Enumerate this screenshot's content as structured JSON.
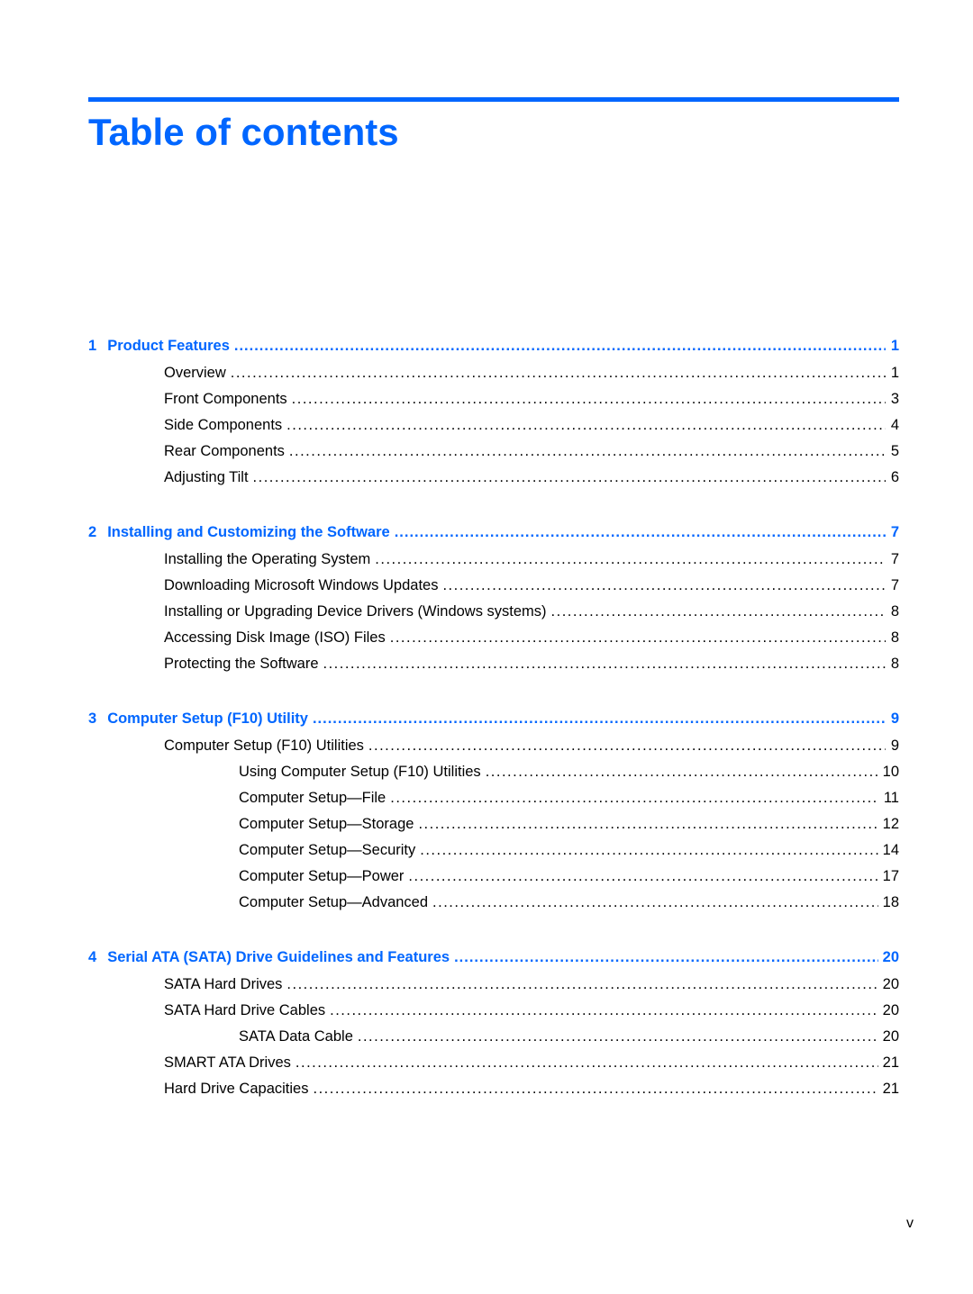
{
  "title": "Table of contents",
  "accent_color": "#0066ff",
  "chapters": [
    {
      "number": "1",
      "title": "Product Features",
      "page": "1",
      "entries": [
        {
          "label": "Overview",
          "page": "1",
          "level": 1
        },
        {
          "label": "Front Components",
          "page": "3",
          "level": 1
        },
        {
          "label": "Side Components",
          "page": "4",
          "level": 1
        },
        {
          "label": "Rear Components",
          "page": "5",
          "level": 1
        },
        {
          "label": "Adjusting Tilt",
          "page": "6",
          "level": 1
        }
      ]
    },
    {
      "number": "2",
      "title": "Installing and Customizing the Software",
      "page": "7",
      "entries": [
        {
          "label": "Installing the Operating System",
          "page": "7",
          "level": 1
        },
        {
          "label": "Downloading Microsoft Windows Updates",
          "page": "7",
          "level": 1
        },
        {
          "label": "Installing or Upgrading Device Drivers (Windows systems)",
          "page": "8",
          "level": 1
        },
        {
          "label": "Accessing Disk Image (ISO) Files",
          "page": "8",
          "level": 1
        },
        {
          "label": "Protecting the Software",
          "page": "8",
          "level": 1
        }
      ]
    },
    {
      "number": "3",
      "title": "Computer Setup (F10) Utility",
      "page": "9",
      "entries": [
        {
          "label": "Computer Setup (F10) Utilities",
          "page": "9",
          "level": 1
        },
        {
          "label": "Using Computer Setup (F10) Utilities",
          "page": "10",
          "level": 2
        },
        {
          "label": "Computer Setup—File",
          "page": "11",
          "level": 2
        },
        {
          "label": "Computer Setup—Storage",
          "page": "12",
          "level": 2
        },
        {
          "label": "Computer Setup—Security",
          "page": "14",
          "level": 2
        },
        {
          "label": "Computer Setup—Power",
          "page": "17",
          "level": 2
        },
        {
          "label": "Computer Setup—Advanced",
          "page": "18",
          "level": 2
        }
      ]
    },
    {
      "number": "4",
      "title": "Serial ATA (SATA) Drive Guidelines and Features",
      "page": "20",
      "entries": [
        {
          "label": "SATA Hard Drives",
          "page": "20",
          "level": 1
        },
        {
          "label": "SATA Hard Drive Cables",
          "page": "20",
          "level": 1
        },
        {
          "label": "SATA Data Cable",
          "page": "20",
          "level": 2
        },
        {
          "label": "SMART ATA Drives",
          "page": "21",
          "level": 1
        },
        {
          "label": "Hard Drive Capacities",
          "page": "21",
          "level": 1
        }
      ]
    }
  ],
  "footer": {
    "page_number": "v"
  }
}
